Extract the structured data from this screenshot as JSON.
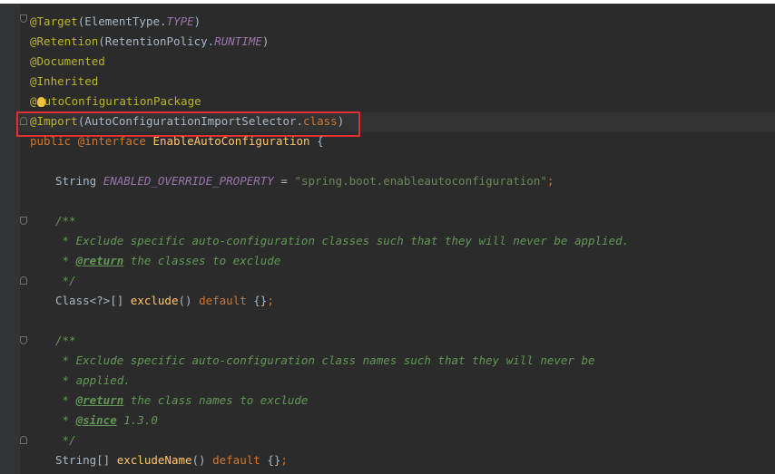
{
  "code": {
    "l1": {
      "at": "@Target",
      "open": "(ElementType.",
      "const": "TYPE",
      "close": ")"
    },
    "l2": {
      "at": "@Retention",
      "open": "(RetentionPolicy.",
      "const": "RUNTIME",
      "close": ")"
    },
    "l3": {
      "at": "@Documented"
    },
    "l4": {
      "at": "@Inherited"
    },
    "l5": {
      "at_a": "@",
      "at_b": "utoConfigurationPackage"
    },
    "l6": {
      "at": "@Import",
      "open": "(AutoConfigurationImportSelector.",
      "kw": "class",
      "close": ")"
    },
    "l7": {
      "kw1": "public ",
      "at": "@interface ",
      "name": "EnableAutoConfiguration",
      "rest": " {"
    },
    "l8": {
      "type": "String ",
      "const": "ENABLED_OVERRIDE_PROPERTY",
      "eq": " = ",
      "str": "\"spring.boot.enableautoconfiguration\"",
      "semi": ";"
    },
    "l9": {
      "doc": "/**"
    },
    "l10": {
      "doc": " * Exclude specific auto-configuration classes such that they will never be applied."
    },
    "l11": {
      "star": " * ",
      "tag": "@return",
      "doc": " the classes to exclude"
    },
    "l12": {
      "doc": " */"
    },
    "l13": {
      "type": "Class<?>[] ",
      "method": "exclude",
      "paren": "() ",
      "kw": "default",
      "rest": " {}",
      "semi": ";"
    },
    "l14": {
      "doc": "/**"
    },
    "l15": {
      "doc": " * Exclude specific auto-configuration class names such that they will never be"
    },
    "l16": {
      "doc": " * applied."
    },
    "l17": {
      "star": " * ",
      "tag": "@return",
      "doc": " the class names to exclude"
    },
    "l18": {
      "star": " * ",
      "tag": "@since",
      "doc": " 1.3.0"
    },
    "l19": {
      "doc": " */"
    },
    "l20": {
      "type": "String[] ",
      "method": "excludeName",
      "paren": "() ",
      "kw": "default",
      "rest": " {}",
      "semi": ";"
    }
  },
  "colors": {
    "background": "#2b2b2b",
    "annotation": "#bbb529",
    "keyword": "#cc7832",
    "string": "#6a8759",
    "constant": "#9876aa",
    "doc": "#629755",
    "method": "#ffc66d",
    "highlight_box": "#e03030"
  },
  "icons": [
    "intention-bulb-icon",
    "fold-marker-icon"
  ]
}
